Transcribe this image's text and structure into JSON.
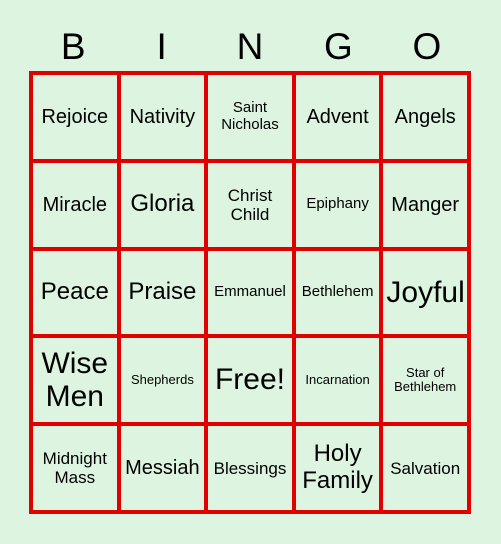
{
  "card": {
    "header_letters": [
      "B",
      "I",
      "N",
      "G",
      "O"
    ],
    "colors": {
      "background": "#ddf5e0",
      "grid_line": "#e00000",
      "text": "#000000"
    },
    "rows": [
      [
        {
          "text": "Rejoice",
          "size": "sz-l"
        },
        {
          "text": "Nativity",
          "size": "sz-l"
        },
        {
          "text": "Saint Nicholas",
          "size": "sz-s"
        },
        {
          "text": "Advent",
          "size": "sz-l"
        },
        {
          "text": "Angels",
          "size": "sz-l"
        }
      ],
      [
        {
          "text": "Miracle",
          "size": "sz-l"
        },
        {
          "text": "Gloria",
          "size": "sz-xl"
        },
        {
          "text": "Christ Child",
          "size": "sz-m"
        },
        {
          "text": "Epiphany",
          "size": "sz-s"
        },
        {
          "text": "Manger",
          "size": "sz-l"
        }
      ],
      [
        {
          "text": "Peace",
          "size": "sz-xl"
        },
        {
          "text": "Praise",
          "size": "sz-xl"
        },
        {
          "text": "Emmanuel",
          "size": "sz-s"
        },
        {
          "text": "Bethlehem",
          "size": "sz-s"
        },
        {
          "text": "Joyful",
          "size": "sz-xxl"
        }
      ],
      [
        {
          "text": "Wise Men",
          "size": "sz-xxl"
        },
        {
          "text": "Shepherds",
          "size": "sz-xs"
        },
        {
          "text": "Free!",
          "size": "sz-xxl"
        },
        {
          "text": "Incarnation",
          "size": "sz-xs"
        },
        {
          "text": "Star of Bethlehem",
          "size": "sz-xs"
        }
      ],
      [
        {
          "text": "Midnight Mass",
          "size": "sz-m"
        },
        {
          "text": "Messiah",
          "size": "sz-l"
        },
        {
          "text": "Blessings",
          "size": "sz-m"
        },
        {
          "text": "Holy Family",
          "size": "sz-xl"
        },
        {
          "text": "Salvation",
          "size": "sz-m"
        }
      ]
    ]
  }
}
